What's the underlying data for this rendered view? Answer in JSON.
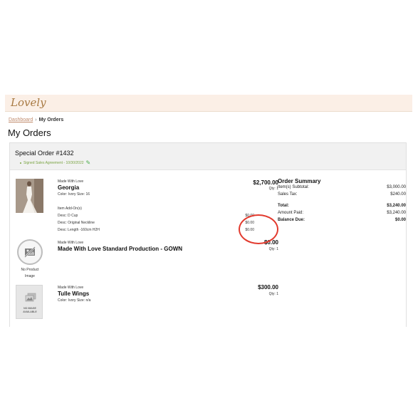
{
  "header": {
    "logo_text": "Lovely"
  },
  "breadcrumb": {
    "link_label": "Dashboard",
    "separator": "›",
    "current": "My Orders"
  },
  "page": {
    "title": "My Orders"
  },
  "order": {
    "title": "Special Order #1432",
    "agreement_label": "Signed Sales Agreement - 10/30/2022",
    "items": [
      {
        "brand": "Made With Love",
        "name": "Georgia",
        "attributes": [
          "Color: Ivory Size: 16"
        ],
        "price": "$2,700.00",
        "qty": "Qty: 1",
        "addons_label": "Item Add-On(s)",
        "addons": [
          {
            "label": "Desc: D Cup",
            "value": "$0.00"
          },
          {
            "label": "Desc: Original Neckline",
            "value": "$0.00"
          },
          {
            "label": "Desc: Length -160cm H2H",
            "value": "$0.00"
          }
        ]
      },
      {
        "brand": "Made With Love",
        "name": "Made With Love Standard Production - GOWN",
        "price": "$0.00",
        "qty": "Qty: 1",
        "image_label_1": "No Product",
        "image_label_2": "Image"
      },
      {
        "brand": "Made With Love",
        "name": "Tulle Wings",
        "attributes": [
          "Color: Ivory Size: n/a"
        ],
        "price": "$300.00",
        "qty": "Qty: 1",
        "image_text_1": "NO IMAGE",
        "image_text_2": "AVAILABLE"
      }
    ]
  },
  "summary": {
    "title": "Order Summary",
    "subtotal_label": "Item(s) Subtotal:",
    "subtotal_value": "$3,000.00",
    "tax_label": "Sales Tax:",
    "tax_value": "$240.00",
    "total_label": "Total:",
    "total_value": "$3,240.00",
    "paid_label": "Amount Paid:",
    "paid_value": "$3,240.00",
    "due_label": "Balance Due:",
    "due_value": "$0.00"
  },
  "colors": {
    "header_bg": "#fbefe6",
    "logo": "#a87a43",
    "link": "#c08a6b",
    "agreement": "#7aa443",
    "highlight": "#e23a2e"
  },
  "icons": {
    "edit": "pencil-icon",
    "no_image": "image-slash-icon"
  }
}
